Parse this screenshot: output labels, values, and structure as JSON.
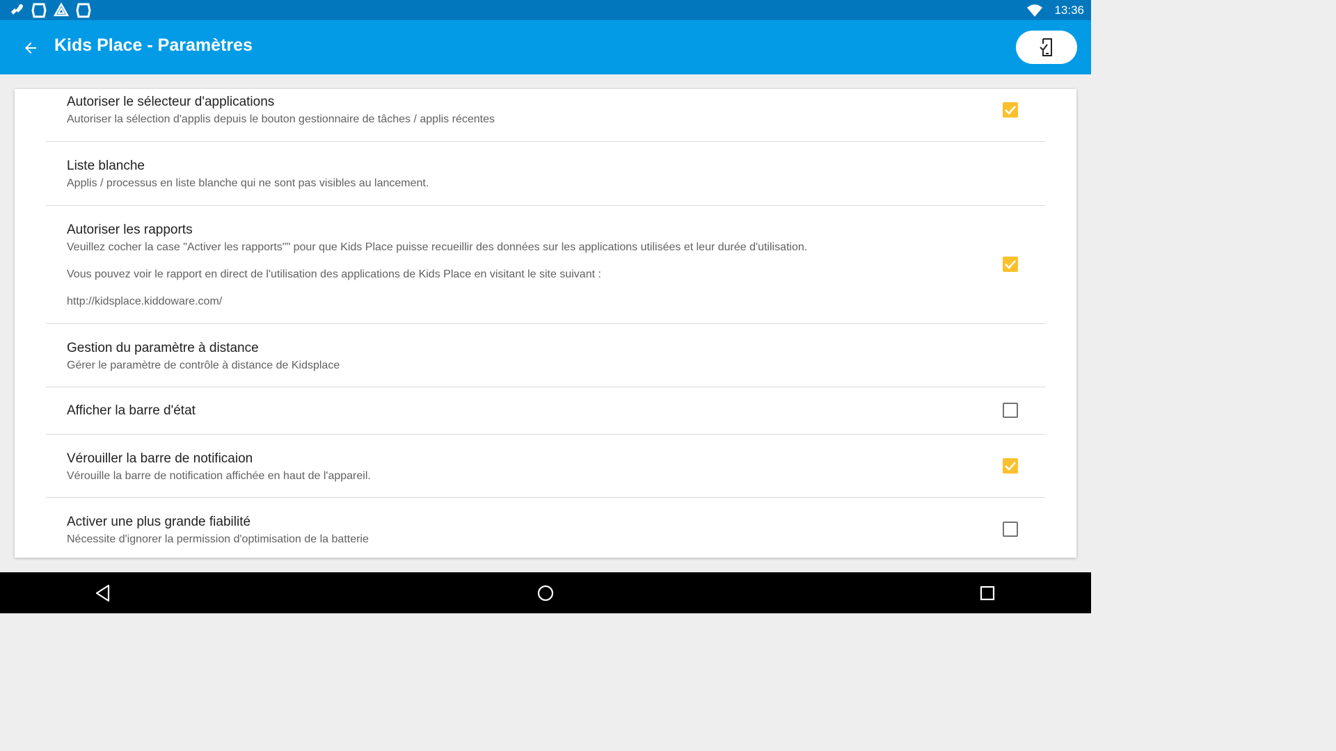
{
  "status_bar": {
    "time": "13:36",
    "left_icons": [
      "app-icon",
      "app-icon",
      "drive-icon",
      "app-icon"
    ],
    "wifi_icon": "wifi-icon"
  },
  "app_bar": {
    "title": "Kids Place - Paramètres",
    "back_icon": "arrow-back-icon",
    "action_icon": "phone-exit-icon",
    "color": "#039be5",
    "status_color": "#0277bd"
  },
  "settings": [
    {
      "title": "Autoriser le sélecteur d'applications",
      "summary": "Autoriser la sélection d'applis depuis le bouton gestionnaire de tâches / applis récentes",
      "checkbox": "checked"
    },
    {
      "title": "Liste blanche",
      "summary": "Applis / processus en liste blanche qui ne sont pas visibles au lancement.",
      "checkbox": "none"
    },
    {
      "title": "Autoriser les rapports",
      "summary_lines": [
        "Veuillez cocher la case \"Activer les rapports\"\" pour que Kids Place puisse recueillir des données sur les applications utilisées et leur durée d'utilisation.",
        "Vous pouvez voir le rapport en direct de l'utilisation des applications de Kids Place en visitant le site suivant :",
        "http://kidsplace.kiddoware.com/"
      ],
      "checkbox": "checked"
    },
    {
      "title": "Gestion du paramètre à distance",
      "summary": "Gérer le paramètre de contrôle à distance de Kidsplace",
      "checkbox": "none"
    },
    {
      "title": "Afficher la barre d'état",
      "summary": "",
      "checkbox": "unchecked"
    },
    {
      "title": "Vérouiller la barre de notificaion",
      "summary": "Vérouille la barre de notification affichée en haut de l'appareil.",
      "checkbox": "checked"
    },
    {
      "title": "Activer une plus grande fiabilité",
      "summary": "Nécessite d'ignorer la permission d'optimisation de la batterie",
      "checkbox": "unchecked"
    }
  ],
  "accent_color": "#fbc02d",
  "nav_bar": {
    "back_icon": "nav-back-icon",
    "home_icon": "nav-home-icon",
    "recents_icon": "nav-recents-icon"
  }
}
